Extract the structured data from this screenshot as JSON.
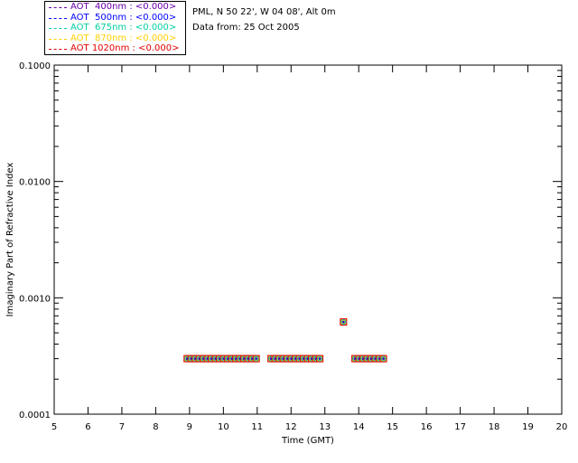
{
  "legend": [
    {
      "label": "AOT  400nm : <0.000>",
      "color": "#6a00a8"
    },
    {
      "label": "AOT  500nm : <0.000>",
      "color": "#0000ff"
    },
    {
      "label": "AOT  675nm : <0.000>",
      "color": "#00d0a0"
    },
    {
      "label": "AOT  870nm : <0.000>",
      "color": "#ffd000"
    },
    {
      "label": "AOT 1020nm : <0.000>",
      "color": "#e00000"
    }
  ],
  "info": {
    "site": "PML, N 50 22', W 04 08', Alt 0m",
    "date": "Data from: 25 Oct 2005"
  },
  "chart_data": {
    "type": "scatter",
    "xlabel": "Time (GMT)",
    "ylabel": "Imaginary Part of Refractive Index",
    "xlim": [
      5,
      20
    ],
    "ylim": [
      0.0001,
      0.1
    ],
    "yscale": "log",
    "xticks": [
      "5",
      "6",
      "7",
      "8",
      "9",
      "10",
      "11",
      "12",
      "13",
      "14",
      "15",
      "16",
      "17",
      "18",
      "19",
      "20"
    ],
    "yticks": [
      "0.0001",
      "0.0010",
      "0.0100",
      "0.1000"
    ],
    "grid": false,
    "legend_position": "top-left",
    "series": [
      {
        "name": "AOT  400nm : <0.000>",
        "color": "#6a00a8"
      },
      {
        "name": "AOT  500nm : <0.000>",
        "color": "#0000ff"
      },
      {
        "name": "AOT  675nm : <0.000>",
        "color": "#00d0a0"
      },
      {
        "name": "AOT  870nm : <0.000>",
        "color": "#ffd000"
      },
      {
        "name": "AOT 1020nm : <0.000>",
        "color": "#e00000"
      }
    ],
    "points": [
      {
        "x": 8.93,
        "y": 0.0003
      },
      {
        "x": 9.05,
        "y": 0.0003
      },
      {
        "x": 9.17,
        "y": 0.0003
      },
      {
        "x": 9.29,
        "y": 0.0003
      },
      {
        "x": 9.41,
        "y": 0.0003
      },
      {
        "x": 9.53,
        "y": 0.0003
      },
      {
        "x": 9.65,
        "y": 0.0003
      },
      {
        "x": 9.77,
        "y": 0.0003
      },
      {
        "x": 9.89,
        "y": 0.0003
      },
      {
        "x": 10.01,
        "y": 0.0003
      },
      {
        "x": 10.13,
        "y": 0.0003
      },
      {
        "x": 10.25,
        "y": 0.0003
      },
      {
        "x": 10.37,
        "y": 0.0003
      },
      {
        "x": 10.49,
        "y": 0.0003
      },
      {
        "x": 10.61,
        "y": 0.0003
      },
      {
        "x": 10.73,
        "y": 0.0003
      },
      {
        "x": 10.85,
        "y": 0.0003
      },
      {
        "x": 10.97,
        "y": 0.0003
      },
      {
        "x": 11.41,
        "y": 0.0003
      },
      {
        "x": 11.53,
        "y": 0.0003
      },
      {
        "x": 11.65,
        "y": 0.0003
      },
      {
        "x": 11.77,
        "y": 0.0003
      },
      {
        "x": 11.89,
        "y": 0.0003
      },
      {
        "x": 12.01,
        "y": 0.0003
      },
      {
        "x": 12.13,
        "y": 0.0003
      },
      {
        "x": 12.25,
        "y": 0.0003
      },
      {
        "x": 12.37,
        "y": 0.0003
      },
      {
        "x": 12.49,
        "y": 0.0003
      },
      {
        "x": 12.61,
        "y": 0.0003
      },
      {
        "x": 12.73,
        "y": 0.0003
      },
      {
        "x": 12.85,
        "y": 0.0003
      },
      {
        "x": 13.55,
        "y": 0.00062
      },
      {
        "x": 13.89,
        "y": 0.0003
      },
      {
        "x": 14.01,
        "y": 0.0003
      },
      {
        "x": 14.13,
        "y": 0.0003
      },
      {
        "x": 14.25,
        "y": 0.0003
      },
      {
        "x": 14.37,
        "y": 0.0003
      },
      {
        "x": 14.49,
        "y": 0.0003
      },
      {
        "x": 14.61,
        "y": 0.0003
      },
      {
        "x": 14.73,
        "y": 0.0003
      }
    ]
  }
}
